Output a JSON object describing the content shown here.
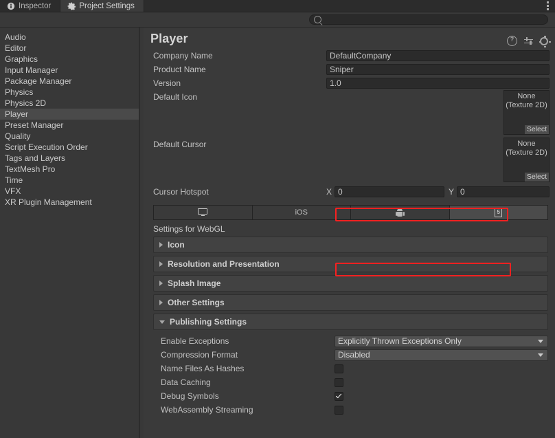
{
  "window": {
    "tabs": [
      {
        "label": "Inspector",
        "icon": "info-icon",
        "active": false
      },
      {
        "label": "Project Settings",
        "icon": "gear-icon",
        "active": true
      }
    ],
    "menu_icon": "kebab-menu-icon"
  },
  "search": {
    "value": "",
    "placeholder": "",
    "icon": "search-icon"
  },
  "sidebar": {
    "items": [
      {
        "label": "Audio",
        "selected": false
      },
      {
        "label": "Editor",
        "selected": false
      },
      {
        "label": "Graphics",
        "selected": false
      },
      {
        "label": "Input Manager",
        "selected": false
      },
      {
        "label": "Package Manager",
        "selected": false
      },
      {
        "label": "Physics",
        "selected": false
      },
      {
        "label": "Physics 2D",
        "selected": false
      },
      {
        "label": "Player",
        "selected": true
      },
      {
        "label": "Preset Manager",
        "selected": false
      },
      {
        "label": "Quality",
        "selected": false
      },
      {
        "label": "Script Execution Order",
        "selected": false
      },
      {
        "label": "Tags and Layers",
        "selected": false
      },
      {
        "label": "TextMesh Pro",
        "selected": false
      },
      {
        "label": "Time",
        "selected": false
      },
      {
        "label": "VFX",
        "selected": false
      },
      {
        "label": "XR Plugin Management",
        "selected": false
      }
    ]
  },
  "panel": {
    "title": "Player",
    "header_icons": [
      {
        "name": "help-icon"
      },
      {
        "name": "preset-icon"
      },
      {
        "name": "gear-icon"
      }
    ],
    "fields": [
      {
        "label": "Company Name",
        "value": "DefaultCompany"
      },
      {
        "label": "Product Name",
        "value": "Sniper"
      },
      {
        "label": "Version",
        "value": "1.0"
      }
    ],
    "default_icon": {
      "label": "Default Icon",
      "object_value": "None",
      "object_type": "(Texture 2D)",
      "select_label": "Select"
    },
    "default_cursor": {
      "label": "Default Cursor",
      "object_value": "None",
      "object_type": "(Texture 2D)",
      "select_label": "Select"
    },
    "cursor_hotspot": {
      "label": "Cursor Hotspot",
      "x_label": "X",
      "x_value": "0",
      "y_label": "Y",
      "y_value": "0"
    }
  },
  "platform_tabs": [
    {
      "name": "standalone",
      "label": "",
      "icon": "monitor-icon",
      "active": false
    },
    {
      "name": "ios",
      "label": "iOS",
      "icon": "",
      "active": false
    },
    {
      "name": "android",
      "label": "",
      "icon": "android-icon",
      "active": false
    },
    {
      "name": "webgl",
      "label": "",
      "icon": "html5-icon",
      "active": true
    }
  ],
  "settings_for": "Settings for WebGL",
  "sections": [
    {
      "label": "Icon",
      "expanded": false
    },
    {
      "label": "Resolution and Presentation",
      "expanded": false
    },
    {
      "label": "Splash Image",
      "expanded": false
    },
    {
      "label": "Other Settings",
      "expanded": false
    },
    {
      "label": "Publishing Settings",
      "expanded": true
    }
  ],
  "publishing_settings": {
    "rows": [
      {
        "label": "Enable Exceptions",
        "type": "dropdown",
        "value": "Explicitly Thrown Exceptions Only",
        "highlighted": true
      },
      {
        "label": "Compression Format",
        "type": "dropdown",
        "value": "Disabled",
        "highlighted": false
      },
      {
        "label": "Name Files As Hashes",
        "type": "checkbox",
        "checked": false,
        "highlighted": false
      },
      {
        "label": "Data Caching",
        "type": "checkbox",
        "checked": false,
        "highlighted": false
      },
      {
        "label": "Debug Symbols",
        "type": "checkbox",
        "checked": true,
        "highlighted": true
      },
      {
        "label": "WebAssembly Streaming",
        "type": "checkbox",
        "checked": false,
        "highlighted": false
      }
    ]
  },
  "colors": {
    "highlight": "#fb2020",
    "panel_bg": "#3a3a3a",
    "sidebar_selected": "#4a4a4a",
    "field_bg": "#2b2b2b"
  }
}
